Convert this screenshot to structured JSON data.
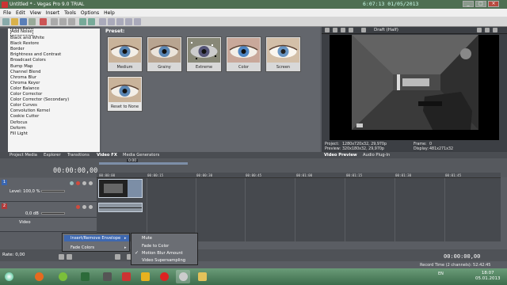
{
  "window": {
    "title": "Untitled * - Vegas Pro 9.0 TRIAL",
    "clock": "6:07:13  01/05/2013"
  },
  "menu": [
    "File",
    "Edit",
    "View",
    "Insert",
    "Tools",
    "Options",
    "Help"
  ],
  "fx_list": [
    "Add Noise",
    "Black and White",
    "Black Restore",
    "Border",
    "Brightness and Contrast",
    "Broadcast Colors",
    "Bump Map",
    "Channel Blend",
    "Chroma Blur",
    "Chroma Keyer",
    "Color Balance",
    "Color Corrector",
    "Color Corrector (Secondary)",
    "Color Curves",
    "Convolution Kernel",
    "Cookie Cutter",
    "Defocus",
    "Deform",
    "Fill Light"
  ],
  "presets": {
    "label": "Preset:",
    "items": [
      "Medium",
      "Grainy",
      "Extreme",
      "Color",
      "Screen",
      "Reset to None"
    ]
  },
  "preview": {
    "quality": "Draft (Half)",
    "project_label": "Project:",
    "project_value": "1280x720x32, 29,970p",
    "preview_label": "Preview:",
    "preview_value": "320x180x32, 29,970p",
    "frame_label": "Frame:",
    "frame_value": "0",
    "display_label": "Display:",
    "display_value": "481x271x32"
  },
  "tabs": [
    "Project Media",
    "Explorer",
    "Transitions",
    "Video FX",
    "Media Generators",
    "Video Preview",
    "Audio Plug-In"
  ],
  "timeline": {
    "timecode": "00:00:00,00",
    "loop_marker": "0:00",
    "ruler": [
      "00:00:00",
      "00:00:15",
      "00:00:30",
      "00:00:45",
      "00:01:00",
      "00:01:15",
      "00:01:30",
      "00:01:45"
    ]
  },
  "tracks": [
    {
      "num": "1",
      "level": "Level: 100,0 %"
    },
    {
      "num": "2",
      "level": "0,0 dB"
    },
    {
      "num": "",
      "level": "Video"
    }
  ],
  "context_menu": {
    "items": [
      "Insert/Remove Envelope",
      "Fade Colors"
    ]
  },
  "submenu": {
    "items": [
      "Mute",
      "Fade to Color",
      "Motion Blur Amount",
      "Video Supersampling"
    ],
    "checked": "✓"
  },
  "status": {
    "rate": "Rate: 0,00",
    "timecode": "00:00:00,00",
    "record_time": "Record Time (2 channels): 52:42:45"
  },
  "taskbar": {
    "language": "EN",
    "time": "18:07",
    "date": "05.01.2013"
  },
  "colors": {
    "accent": "#3e68b0",
    "titlebar": "#4e6f52",
    "panel": "#5a5d63"
  }
}
